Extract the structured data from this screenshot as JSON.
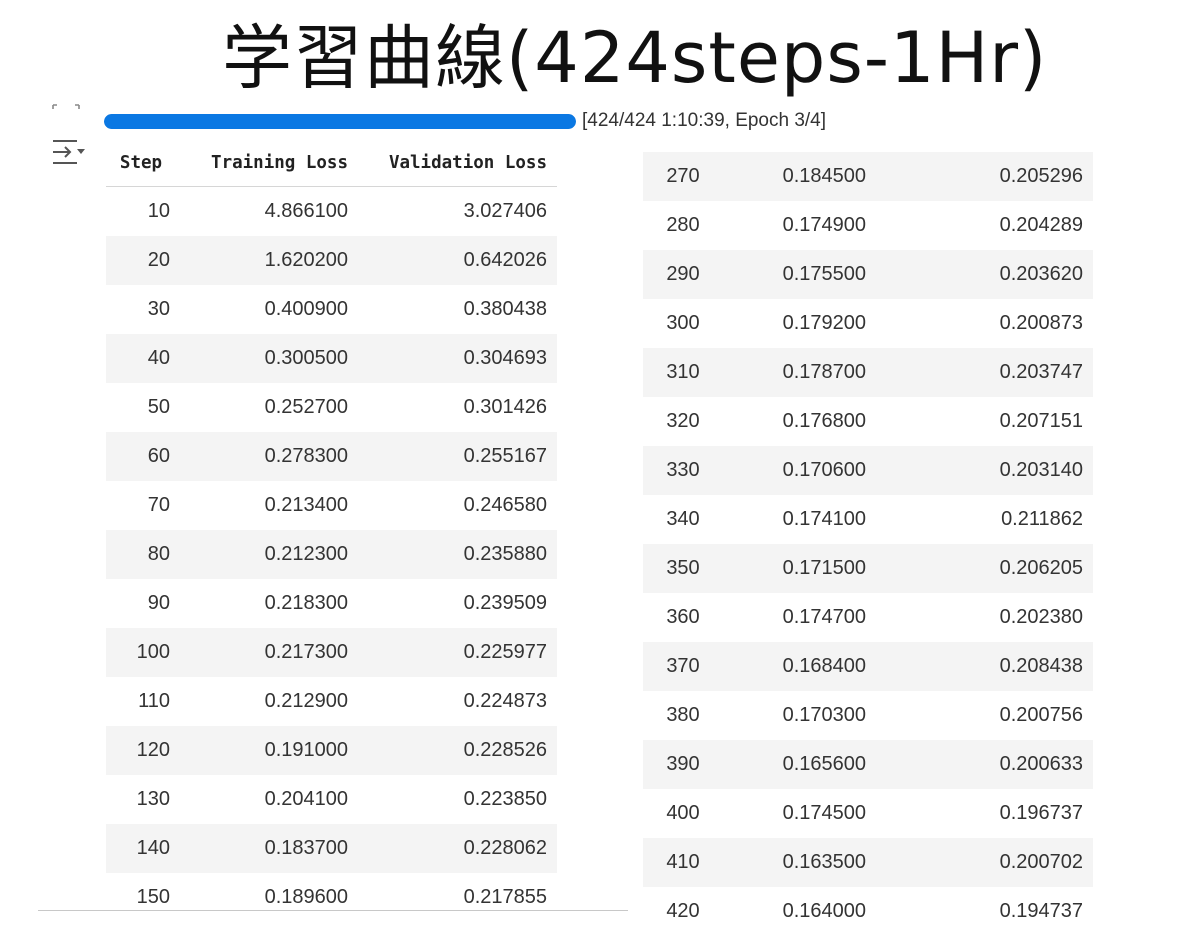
{
  "title": "学習曲線(424steps-1Hr)",
  "progress": {
    "fraction": 1.0,
    "text": "[424/424 1:10:39, Epoch 3/4]",
    "bar_color": "#0b78e3"
  },
  "icons": {
    "expand": "expand-output-icon",
    "output": "output-toggle-icon"
  },
  "table": {
    "headers": [
      "Step",
      "Training Loss",
      "Validation Loss"
    ],
    "left_rows": [
      [
        "10",
        "4.866100",
        "3.027406"
      ],
      [
        "20",
        "1.620200",
        "0.642026"
      ],
      [
        "30",
        "0.400900",
        "0.380438"
      ],
      [
        "40",
        "0.300500",
        "0.304693"
      ],
      [
        "50",
        "0.252700",
        "0.301426"
      ],
      [
        "60",
        "0.278300",
        "0.255167"
      ],
      [
        "70",
        "0.213400",
        "0.246580"
      ],
      [
        "80",
        "0.212300",
        "0.235880"
      ],
      [
        "90",
        "0.218300",
        "0.239509"
      ],
      [
        "100",
        "0.217300",
        "0.225977"
      ],
      [
        "110",
        "0.212900",
        "0.224873"
      ],
      [
        "120",
        "0.191000",
        "0.228526"
      ],
      [
        "130",
        "0.204100",
        "0.223850"
      ],
      [
        "140",
        "0.183700",
        "0.228062"
      ],
      [
        "150",
        "0.189600",
        "0.217855"
      ]
    ],
    "right_rows": [
      [
        "270",
        "0.184500",
        "0.205296"
      ],
      [
        "280",
        "0.174900",
        "0.204289"
      ],
      [
        "290",
        "0.175500",
        "0.203620"
      ],
      [
        "300",
        "0.179200",
        "0.200873"
      ],
      [
        "310",
        "0.178700",
        "0.203747"
      ],
      [
        "320",
        "0.176800",
        "0.207151"
      ],
      [
        "330",
        "0.170600",
        "0.203140"
      ],
      [
        "340",
        "0.174100",
        "0.211862"
      ],
      [
        "350",
        "0.171500",
        "0.206205"
      ],
      [
        "360",
        "0.174700",
        "0.202380"
      ],
      [
        "370",
        "0.168400",
        "0.208438"
      ],
      [
        "380",
        "0.170300",
        "0.200756"
      ],
      [
        "390",
        "0.165600",
        "0.200633"
      ],
      [
        "400",
        "0.174500",
        "0.196737"
      ],
      [
        "410",
        "0.163500",
        "0.200702"
      ],
      [
        "420",
        "0.164000",
        "0.194737"
      ]
    ]
  }
}
